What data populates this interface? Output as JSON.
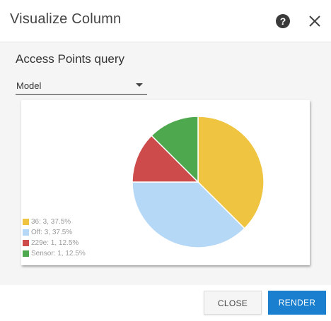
{
  "dialog": {
    "title": "Visualize Column",
    "help_label": "?",
    "close_icon": "close-icon"
  },
  "query": {
    "title": "Access Points query"
  },
  "column_select": {
    "value": "Model",
    "icon": "chevron-down-icon"
  },
  "chart_data": {
    "type": "pie",
    "title": "",
    "legend_position": "bottom-left",
    "slices": [
      {
        "label": "36",
        "value": 3,
        "percent": 37.5,
        "color": "#eec441",
        "legend": "36: 3, 37.5%"
      },
      {
        "label": "Off",
        "value": 3,
        "percent": 37.5,
        "color": "#b5d8f7",
        "legend": "Off: 3, 37.5%"
      },
      {
        "label": "229e",
        "value": 1,
        "percent": 12.5,
        "color": "#cd4b4b",
        "legend": "229e: 1, 12.5%"
      },
      {
        "label": "Sensor",
        "value": 1,
        "percent": 12.5,
        "color": "#4ea84e",
        "legend": "Sensor: 1, 12.5%"
      }
    ]
  },
  "footer": {
    "close_label": "CLOSE",
    "render_label": "RENDER"
  }
}
